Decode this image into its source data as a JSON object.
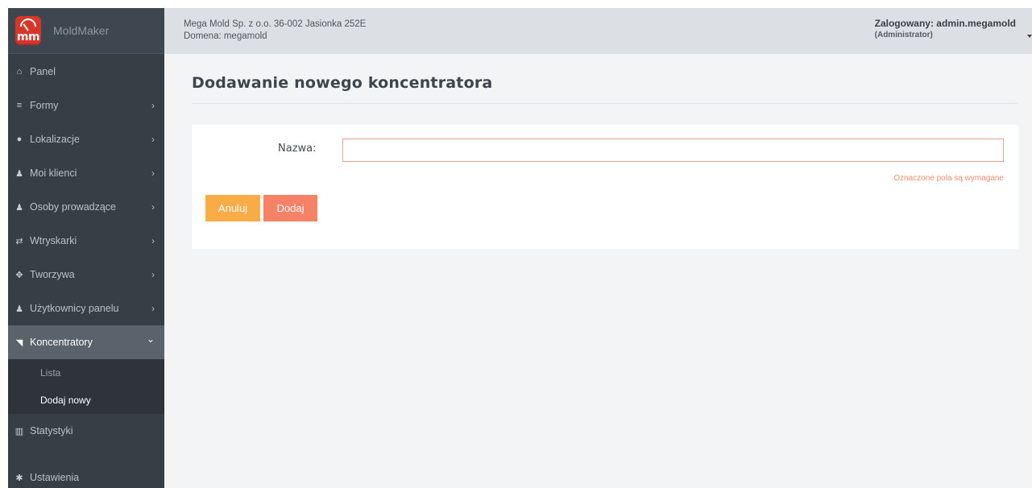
{
  "brand": {
    "name": "MoldMaker",
    "logo_text": "mm"
  },
  "header": {
    "company_line": "Mega Mold Sp. z o.o. 36-002 Jasionka 252E",
    "domain_line": "Domena: megamold",
    "user_line": "Zalogowany: admin.megamold",
    "role_line": "(Administrator)"
  },
  "sidebar": {
    "items": [
      {
        "label": "Panel",
        "icon": "home-icon",
        "glyph": "⌂",
        "has_children": false
      },
      {
        "label": "Formy",
        "icon": "database-icon",
        "glyph": "≡",
        "has_children": true
      },
      {
        "label": "Lokalizacje",
        "icon": "map-marker-icon",
        "glyph": "●",
        "has_children": true
      },
      {
        "label": "Moi klienci",
        "icon": "user-icon",
        "glyph": "♟",
        "has_children": true
      },
      {
        "label": "Osoby prowadzące",
        "icon": "users-icon",
        "glyph": "♟",
        "has_children": true
      },
      {
        "label": "Wtryskarki",
        "icon": "exchange-icon",
        "glyph": "⇄",
        "has_children": true
      },
      {
        "label": "Tworzywa",
        "icon": "crosshairs-icon",
        "glyph": "✥",
        "has_children": true
      },
      {
        "label": "Użytkownicy panelu",
        "icon": "user-icon",
        "glyph": "♟",
        "has_children": true
      },
      {
        "label": "Koncentratory",
        "icon": "rss-icon",
        "glyph": "◥",
        "has_children": true,
        "active": true
      }
    ],
    "submenu": [
      {
        "label": "Lista"
      },
      {
        "label": "Dodaj nowy",
        "current": true
      }
    ],
    "bottom_items": [
      {
        "label": "Statystyki",
        "icon": "bar-chart-icon",
        "glyph": "▥"
      },
      {
        "label": "Ustawienia",
        "icon": "gear-icon",
        "glyph": "✱"
      }
    ],
    "chevron_right": "›",
    "chevron_down": "⌄"
  },
  "main": {
    "title": "Dodawanie nowego koncentratora",
    "form": {
      "name_label": "Nazwa:",
      "name_value": "",
      "required_note": "Oznaczone pola są wymagane",
      "cancel_label": "Anuluj",
      "add_label": "Dodaj"
    }
  },
  "colors": {
    "sidebar_bg": "#373f46",
    "active_item": "#5a636b",
    "header_bg": "#dcdfe4",
    "cancel_button": "#f8ac45",
    "add_button": "#f58266",
    "required_text": "#ef8b73"
  }
}
